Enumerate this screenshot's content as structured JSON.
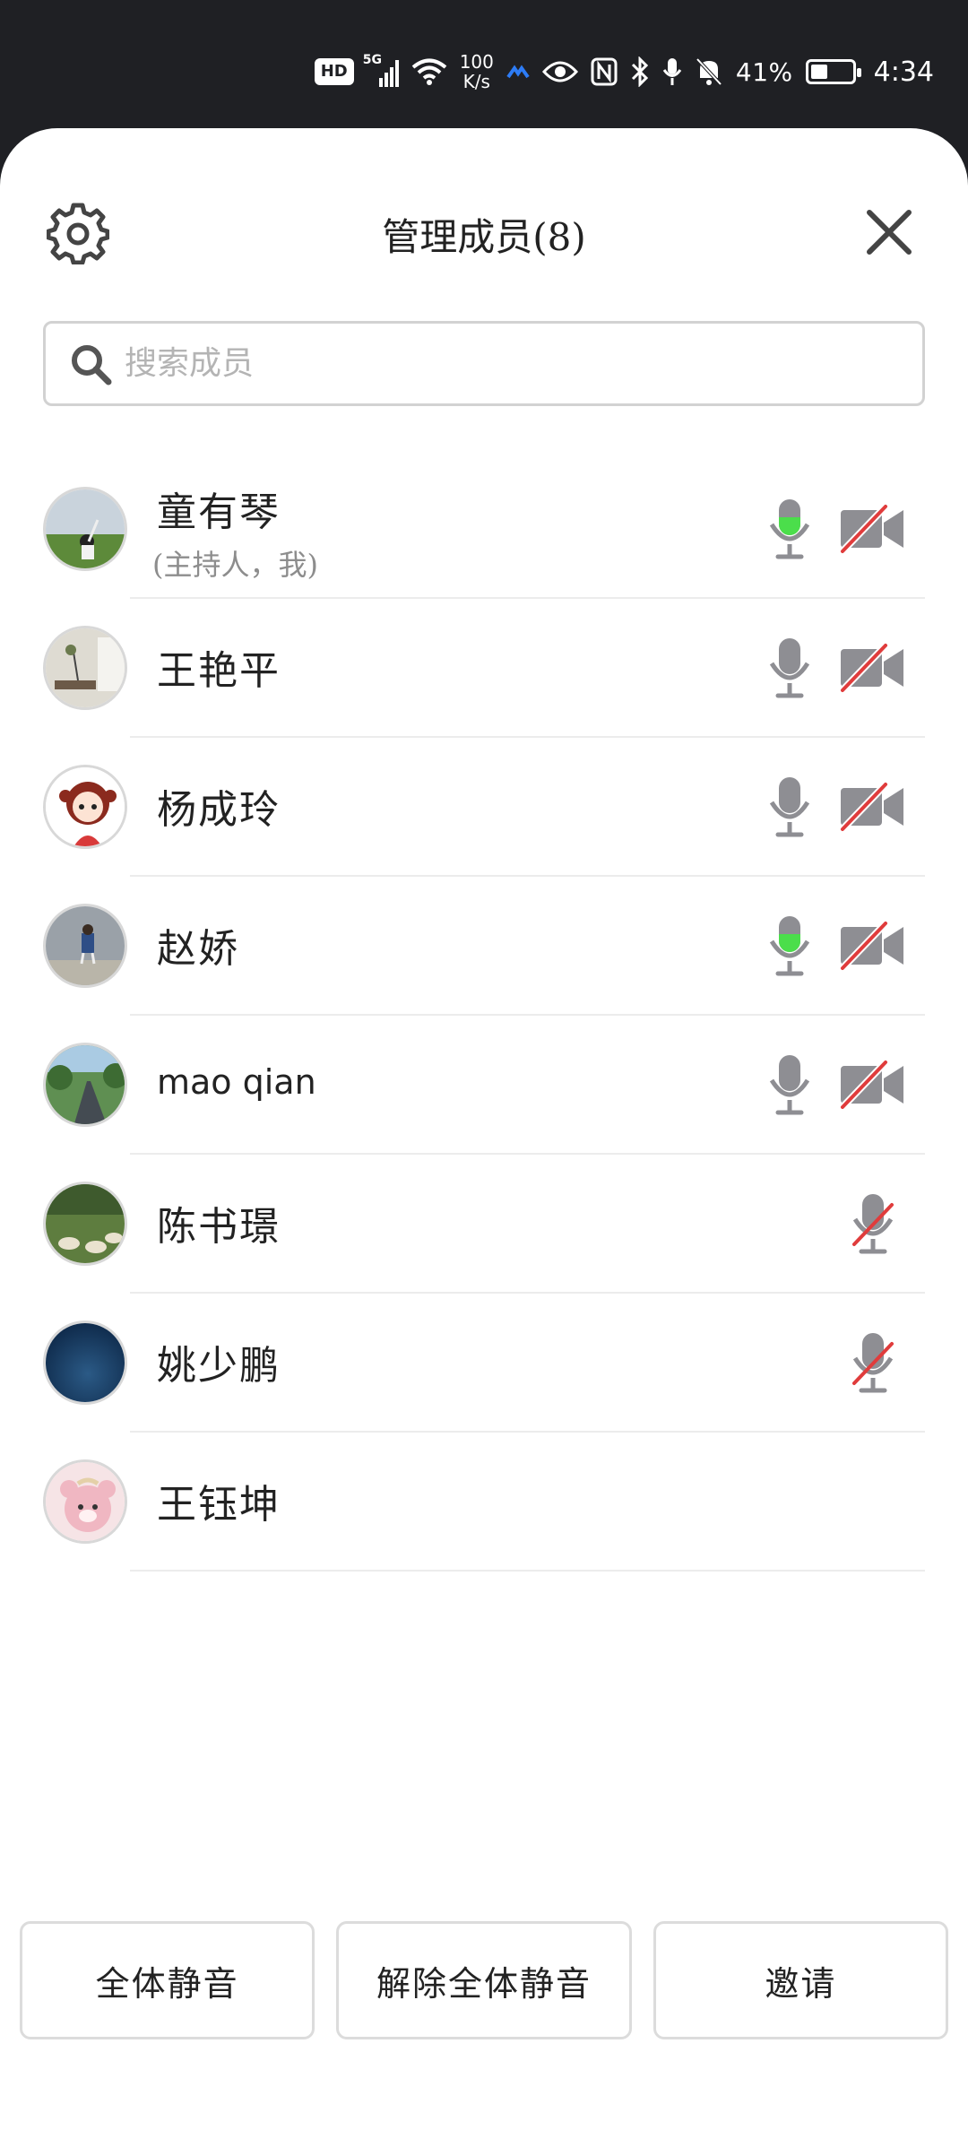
{
  "status_bar": {
    "hd": "HD",
    "network": "5G",
    "speed_value": "100",
    "speed_unit": "K/s",
    "battery_text": "41%",
    "battery_level": 0.41,
    "time": "4:34",
    "icons": [
      "hd-icon",
      "signal-icon",
      "wifi-icon",
      "app-icon",
      "eye-icon",
      "nfc-icon",
      "bluetooth-icon",
      "mic-icon",
      "mute-bell-icon",
      "battery-icon"
    ]
  },
  "header": {
    "title": "管理成员(8)",
    "settings_icon": "gear-icon",
    "close_icon": "close-icon"
  },
  "search": {
    "placeholder": "搜索成员",
    "icon": "search-icon"
  },
  "members": [
    {
      "name": "童有琴",
      "sub": "(主持人，我)",
      "mic": "active",
      "camera": "off",
      "avatar": "landscape-person"
    },
    {
      "name": "王艳平",
      "sub": "",
      "mic": "on",
      "camera": "off",
      "avatar": "room-interior"
    },
    {
      "name": "杨成玲",
      "sub": "",
      "mic": "on",
      "camera": "off",
      "avatar": "cartoon-girl"
    },
    {
      "name": "赵娇",
      "sub": "",
      "mic": "active",
      "camera": "off",
      "avatar": "child-walking"
    },
    {
      "name": "mao qian",
      "sub": "",
      "mic": "on",
      "camera": "off",
      "avatar": "road-trees"
    },
    {
      "name": "陈书璟",
      "sub": "",
      "mic": "muted",
      "camera": "none",
      "avatar": "sheep-field"
    },
    {
      "name": "姚少鹏",
      "sub": "",
      "mic": "muted",
      "camera": "none",
      "avatar": "night-moon"
    },
    {
      "name": "王钰坤",
      "sub": "",
      "mic": "none",
      "camera": "none",
      "avatar": "pink-bear"
    }
  ],
  "footer": {
    "mute_all": "全体静音",
    "unmute_all": "解除全体静音",
    "invite": "邀请"
  },
  "colors": {
    "mic_active": "#4bde4b",
    "icon_gray": "#8e8e93",
    "slash_red": "#e03c3c"
  }
}
